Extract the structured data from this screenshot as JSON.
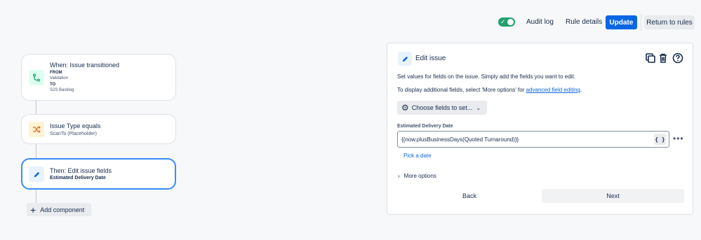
{
  "colors": {
    "accent": "#0c66e4",
    "toggle_on": "#22a06b",
    "selected_border": "#388bff"
  },
  "topbar": {
    "toggle_checked": true,
    "audit_log": "Audit log",
    "rule_details": "Rule details",
    "update": "Update",
    "return_to_rules": "Return to rules"
  },
  "flow": {
    "trigger": {
      "icon": "branch-icon",
      "title": "When: Issue transitioned",
      "from_label": "FROM",
      "from_value": "Validation",
      "to_label": "TO",
      "to_value": "S2S Backlog"
    },
    "condition": {
      "icon": "shuffle-icon",
      "title": "Issue Type equals",
      "subtitle": "ScanTo (Placeholder)"
    },
    "action": {
      "icon": "pencil-icon",
      "title": "Then: Edit issue fields",
      "subtitle": "Estimated Delivery Date"
    },
    "add_component": "Add component"
  },
  "panel": {
    "title": "Edit issue",
    "description_1": "Set values for fields on the issue. Simply add the fields you want to edit.",
    "description_2_prefix": "To display additional fields, select 'More options' for ",
    "description_2_link": "advanced field editing",
    "description_2_suffix": ".",
    "choose_fields": "Choose fields to set...",
    "field_label": "Estimated Delivery Date",
    "field_value": "{{now.plusBusinessDays(Quoted Turnaround)}}",
    "smart_value_button": "{ }",
    "pick_date": "Pick a date",
    "more_options": "More options",
    "back": "Back",
    "next": "Next"
  }
}
